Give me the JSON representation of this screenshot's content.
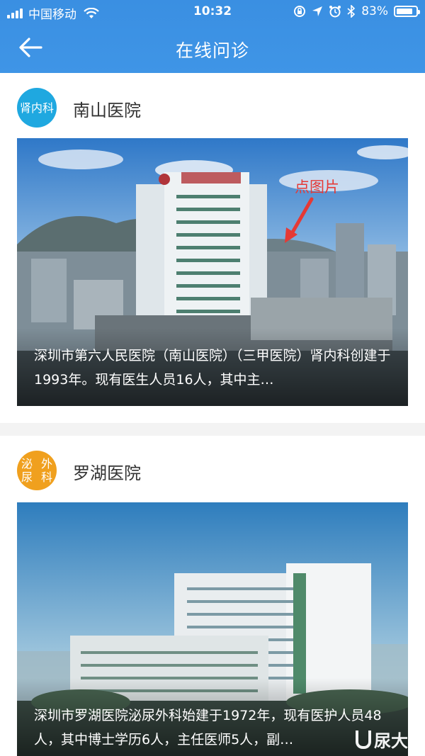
{
  "status_bar": {
    "carrier": "中国移动",
    "time": "10:32",
    "battery": "83%",
    "battery_level": 0.83,
    "icons": [
      "signal-icon",
      "wifi-icon",
      "orientation-lock-icon",
      "location-icon",
      "alarm-icon",
      "bluetooth-icon",
      "battery-icon"
    ]
  },
  "header": {
    "title": "在线问诊",
    "back_icon": "back-arrow-icon",
    "color": "#3b90e4"
  },
  "annotation": {
    "hint": "点图片",
    "color": "#e53935"
  },
  "hospitals": [
    {
      "department": "肾内科",
      "department_color": "#1fa8e0",
      "name": "南山医院",
      "description": "深圳市第六人民医院（南山医院）（三甲医院）肾内科创建于1993年。现有医生人员16人，其中主…"
    },
    {
      "department_line1": "泌尿",
      "department_line2": "外科",
      "department_color": "#f0a01e",
      "name": "罗湖医院",
      "description": "深圳市罗湖医院泌尿外科始建于1972年，现有医护人员48人，其中博士学历6人，主任医师5人，副…"
    }
  ],
  "watermark": "尿大夫"
}
